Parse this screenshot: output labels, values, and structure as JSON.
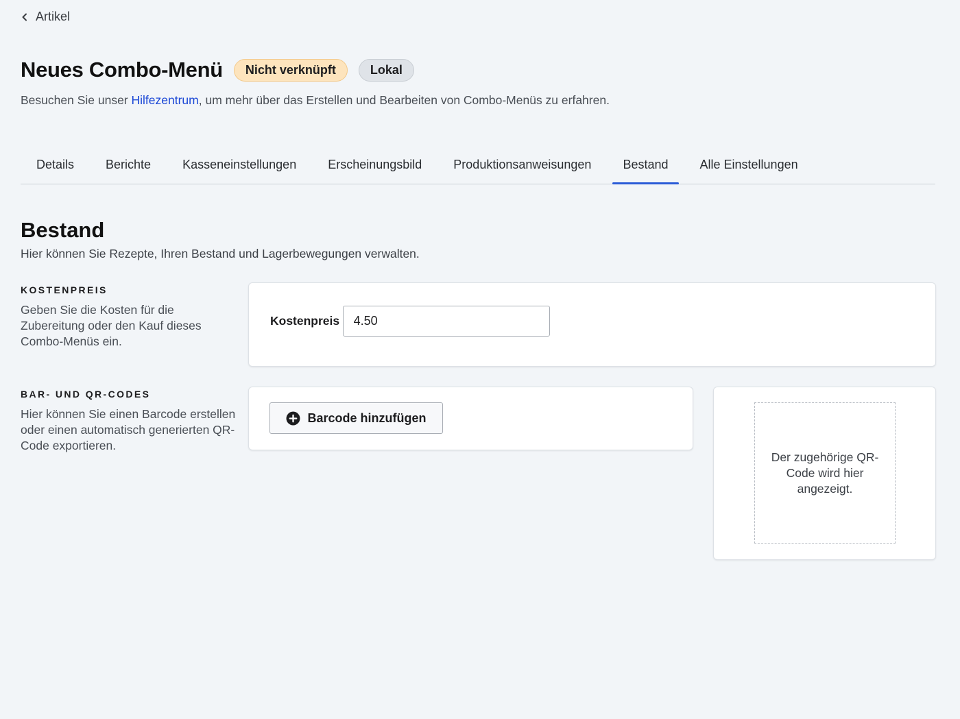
{
  "breadcrumb": {
    "back_label": "Artikel"
  },
  "header": {
    "title": "Neues Combo-Menü",
    "badges": {
      "status": "Nicht verknüpft",
      "scope": "Lokal"
    },
    "help_prefix": "Besuchen Sie unser ",
    "help_link": "Hilfezentrum",
    "help_suffix": ", um mehr über das Erstellen und Bearbeiten von Combo-Menüs zu erfahren."
  },
  "tabs": [
    {
      "label": "Details"
    },
    {
      "label": "Berichte"
    },
    {
      "label": "Kasseneinstellungen"
    },
    {
      "label": "Erscheinungsbild"
    },
    {
      "label": "Produktionsanweisungen"
    },
    {
      "label": "Bestand",
      "active": true
    },
    {
      "label": "Alle Einstellungen"
    }
  ],
  "section": {
    "title": "Bestand",
    "subtitle": "Hier können Sie Rezepte, Ihren Bestand und Lagerbewegungen verwalten."
  },
  "cost": {
    "caption": "KOSTENPREIS",
    "description": "Geben Sie die Kosten für die Zubereitung oder den Kauf dieses Combo-Menüs ein.",
    "field_label": "Kostenpreis",
    "value": "4.50"
  },
  "codes": {
    "caption": "BAR- UND QR-CODES",
    "description": "Hier können Sie einen Barcode erstellen oder einen automatisch generierten QR-Code exportieren.",
    "add_button": "Barcode hinzufügen",
    "qr_placeholder": "Der zugehörige QR-Code wird hier angezeigt."
  },
  "colors": {
    "accent": "#2a5bd7",
    "link": "#1a47d6",
    "warn_badge": "#fde4bd",
    "background": "#f2f5f8"
  }
}
